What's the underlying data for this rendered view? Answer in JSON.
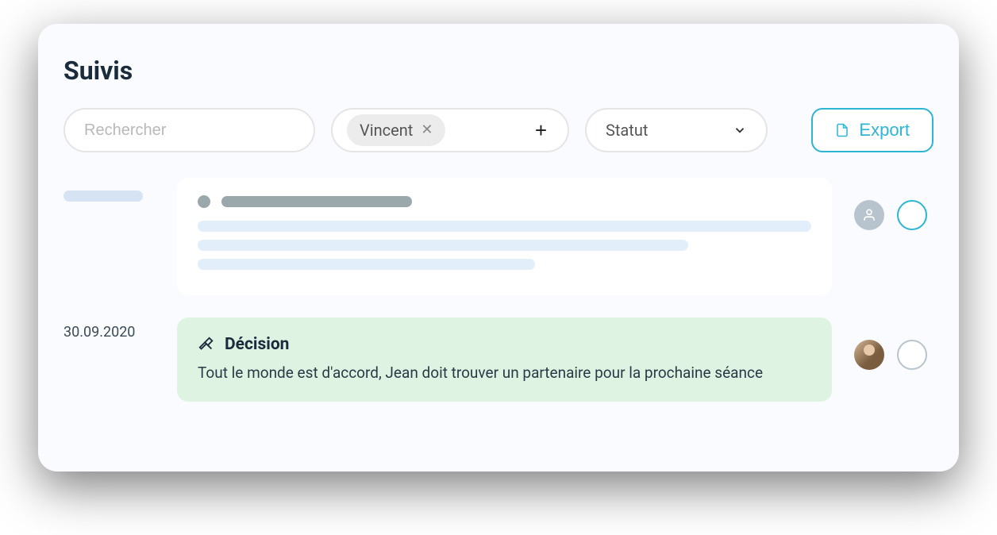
{
  "title": "Suivis",
  "toolbar": {
    "search_placeholder": "Rechercher",
    "filter_chip": "Vincent",
    "status_label": "Statut",
    "export_label": "Export"
  },
  "rows": [
    {
      "date": "",
      "type": "skeleton"
    },
    {
      "date": "30.09.2020",
      "type": "decision",
      "title": "Décision",
      "body": "Tout le monde est d'accord, Jean doit trouver un partenaire pour la prochaine séance"
    }
  ],
  "colors": {
    "accent": "#2eb5d4",
    "decision_bg": "#dff3e3"
  }
}
